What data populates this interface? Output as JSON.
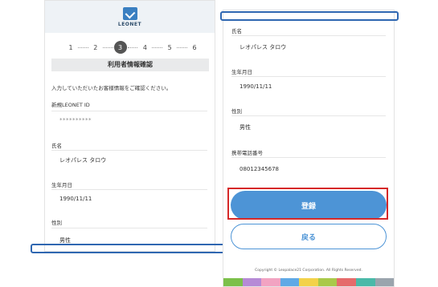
{
  "left": {
    "logo_text": "LEONET",
    "steps": [
      "1",
      "2",
      "3",
      "4",
      "5",
      "6"
    ],
    "active_step": "3",
    "section_title": "利用者情報確認",
    "intro": "入力していただいたお客様情報をご確認ください。",
    "fields": [
      {
        "label": "新規LEONET ID",
        "value": "**********"
      },
      {
        "label": "氏名",
        "value": "レオパレス タロウ"
      },
      {
        "label": "生年月日",
        "value": "1990/11/11"
      },
      {
        "label": "性別",
        "value": "男性"
      }
    ]
  },
  "right": {
    "fields": [
      {
        "label": "氏名",
        "value": "レオパレス タロウ"
      },
      {
        "label": "生年月日",
        "value": "1990/11/11"
      },
      {
        "label": "性別",
        "value": "男性"
      },
      {
        "label": "携帯電話番号",
        "value": "08012345678"
      }
    ],
    "register_label": "登録",
    "back_label": "戻る",
    "copyright": "Copyright © Leopalace21 Corporation. All Rights Reserved."
  },
  "colors": {
    "accent": "#4d94d6",
    "highlight": "#d62828",
    "footer_bar": [
      "#7cc04a",
      "#b68ad6",
      "#f2a3c2",
      "#5fa9e6",
      "#f3d24a",
      "#a9c94a",
      "#e56b6b",
      "#4ab9a8",
      "#9aa4ad"
    ]
  }
}
